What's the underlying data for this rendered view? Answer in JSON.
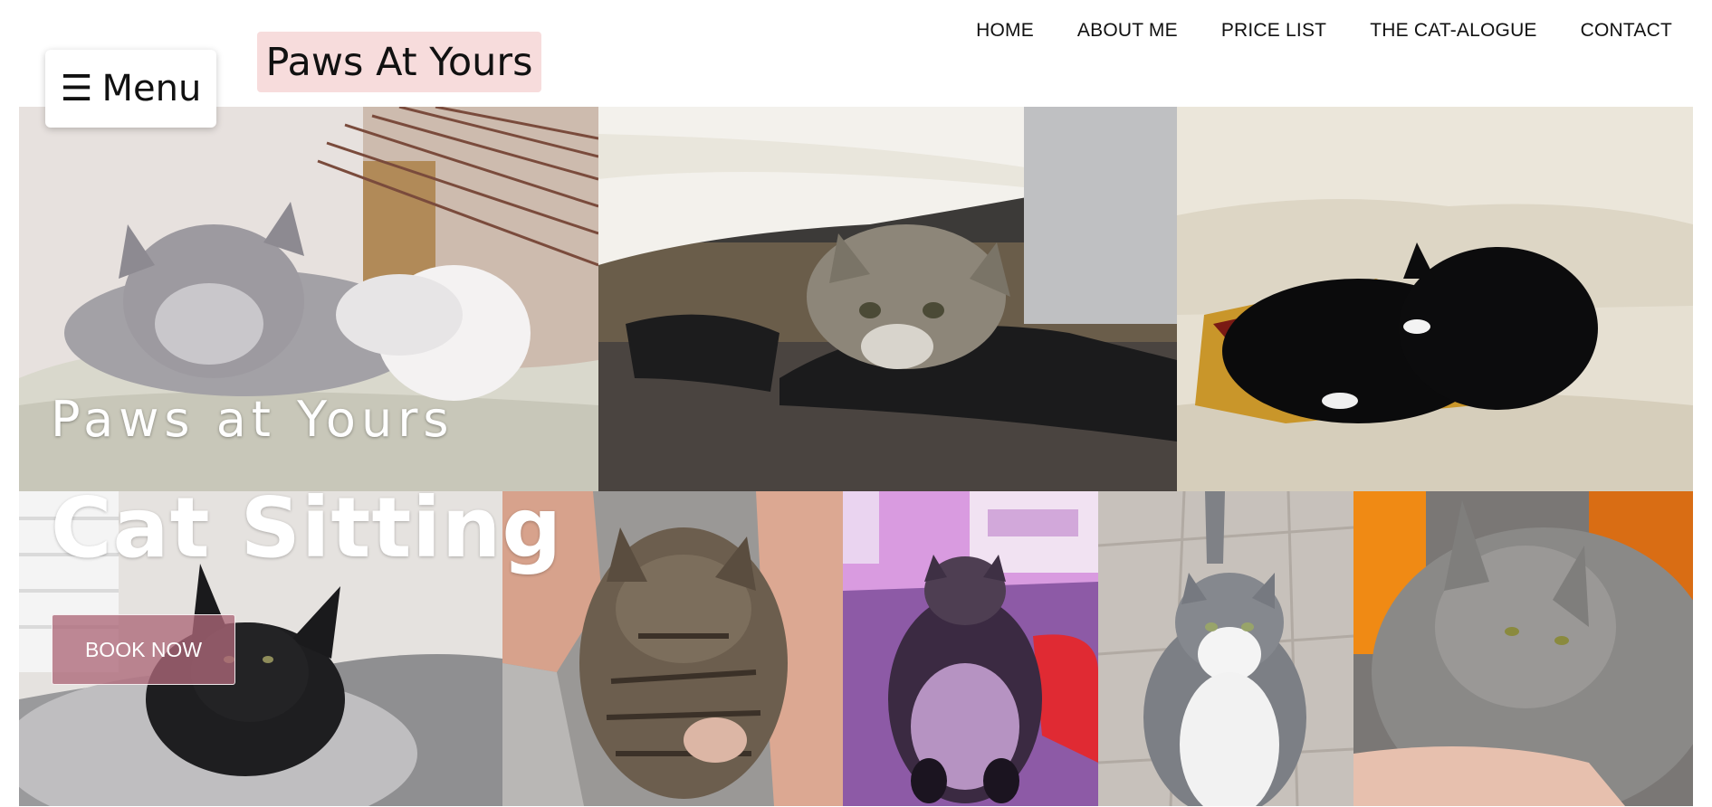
{
  "header": {
    "menu_icon": "☰",
    "menu_label": "Menu",
    "brand": "Paws At Yours"
  },
  "nav": {
    "items": [
      "HOME",
      "ABOUT ME",
      "PRICE LIST",
      "THE CAT-ALOGUE",
      "CONTACT"
    ]
  },
  "hero": {
    "subtitle": "Paws at Yours",
    "title": "Cat Sitting",
    "cta_label": "BOOK NOW"
  },
  "colors": {
    "brand_bg": "#f7dcdc",
    "cta_bg": "#ad6878",
    "text": "#111111"
  },
  "photos": [
    {
      "icon": "fluffy-grey-cat-photo"
    },
    {
      "icon": "grey-cat-under-table-photo"
    },
    {
      "icon": "black-cats-on-sofa-photo"
    },
    {
      "icon": "black-maine-coon-photo"
    },
    {
      "icon": "tabby-kitten-in-hands-photo"
    },
    {
      "icon": "cat-on-purple-rug-photo"
    },
    {
      "icon": "grey-white-cat-standing-photo"
    },
    {
      "icon": "grey-cat-held-photo"
    }
  ]
}
